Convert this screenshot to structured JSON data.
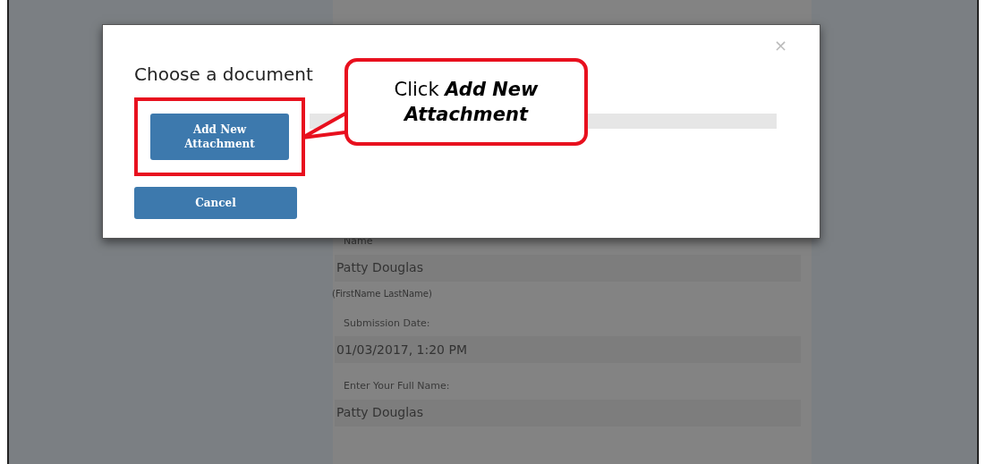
{
  "form": {
    "fields": [
      {
        "label": "Name",
        "value": "Patty Douglas",
        "hint": "(FirstName LastName)"
      },
      {
        "label": "Submission Date:",
        "value": "01/03/2017, 1:20 PM"
      },
      {
        "label": "Enter Your Full Name:",
        "value": "Patty Douglas"
      }
    ]
  },
  "modal": {
    "title": "Choose a document",
    "close": "×",
    "buttons": [
      {
        "label": "Add New Attachment",
        "highlighted": true
      },
      {
        "label": "Cancel",
        "highlighted": false
      }
    ]
  },
  "callout": {
    "text": "Click **Add New Attachment**"
  }
}
